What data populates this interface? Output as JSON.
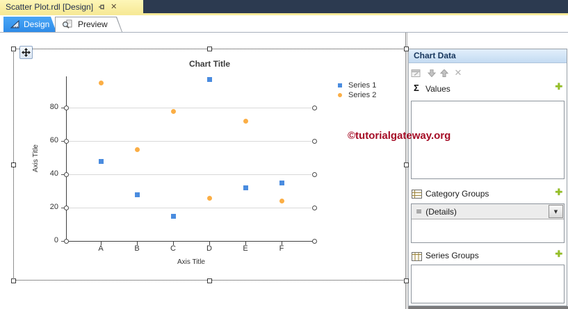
{
  "window": {
    "document_tab": "Scatter Plot.rdl [Design]",
    "close_glyph": "✕"
  },
  "view_tabs": [
    {
      "label": "Design",
      "active": true
    },
    {
      "label": "Preview",
      "active": false
    }
  ],
  "watermark": {
    "text": "©tutorialgateway.org",
    "color": "#A50D26"
  },
  "chart_data": {
    "type": "scatter",
    "title": "Chart Title",
    "xlabel": "Axis Title",
    "ylabel": "Axis Title",
    "categories": [
      "A",
      "B",
      "C",
      "D",
      "E",
      "F"
    ],
    "y_ticks": [
      0,
      20,
      40,
      60,
      80
    ],
    "ylim": [
      0,
      100
    ],
    "grid": true,
    "legend_position": "right-top",
    "series": [
      {
        "name": "Series 1",
        "marker": "square",
        "color": "#4A8CDF",
        "values": [
          48,
          28,
          15,
          97,
          32,
          35
        ]
      },
      {
        "name": "Series 2",
        "marker": "circle",
        "color": "#FBAE45",
        "values": [
          95,
          55,
          78,
          26,
          72,
          24
        ]
      }
    ]
  },
  "panel": {
    "title": "Chart Data",
    "add_glyph": "✚",
    "toolbar": {
      "delete_glyph": "✕"
    },
    "details_grip_glyph": "≡",
    "dropdown_glyph": "▼",
    "sections": [
      {
        "label": "Values",
        "icon": "sigma-icon",
        "icon_glyph": "Σ"
      },
      {
        "label": "Category Groups",
        "icon": "category-groups-icon",
        "items": [
          "(Details)"
        ]
      },
      {
        "label": "Series Groups",
        "icon": "series-groups-icon"
      }
    ]
  },
  "colors": {
    "active_tab_blue": "#3399F0",
    "document_tab_yellow": "#F9EC9A",
    "title_bar_navy": "#2C3A50",
    "add_button_green": "#95BF26",
    "watermark_red": "#A50D26",
    "series1_blue": "#4A8CDF",
    "series2_orange": "#FBAE45"
  }
}
